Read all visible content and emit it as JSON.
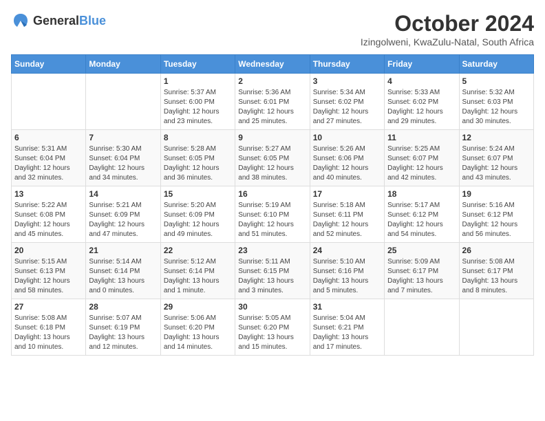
{
  "logo": {
    "general": "General",
    "blue": "Blue"
  },
  "title": "October 2024",
  "subtitle": "Izingolweni, KwaZulu-Natal, South Africa",
  "calendar": {
    "headers": [
      "Sunday",
      "Monday",
      "Tuesday",
      "Wednesday",
      "Thursday",
      "Friday",
      "Saturday"
    ],
    "weeks": [
      [
        {
          "day": "",
          "detail": ""
        },
        {
          "day": "",
          "detail": ""
        },
        {
          "day": "1",
          "detail": "Sunrise: 5:37 AM\nSunset: 6:00 PM\nDaylight: 12 hours\nand 23 minutes."
        },
        {
          "day": "2",
          "detail": "Sunrise: 5:36 AM\nSunset: 6:01 PM\nDaylight: 12 hours\nand 25 minutes."
        },
        {
          "day": "3",
          "detail": "Sunrise: 5:34 AM\nSunset: 6:02 PM\nDaylight: 12 hours\nand 27 minutes."
        },
        {
          "day": "4",
          "detail": "Sunrise: 5:33 AM\nSunset: 6:02 PM\nDaylight: 12 hours\nand 29 minutes."
        },
        {
          "day": "5",
          "detail": "Sunrise: 5:32 AM\nSunset: 6:03 PM\nDaylight: 12 hours\nand 30 minutes."
        }
      ],
      [
        {
          "day": "6",
          "detail": "Sunrise: 5:31 AM\nSunset: 6:04 PM\nDaylight: 12 hours\nand 32 minutes."
        },
        {
          "day": "7",
          "detail": "Sunrise: 5:30 AM\nSunset: 6:04 PM\nDaylight: 12 hours\nand 34 minutes."
        },
        {
          "day": "8",
          "detail": "Sunrise: 5:28 AM\nSunset: 6:05 PM\nDaylight: 12 hours\nand 36 minutes."
        },
        {
          "day": "9",
          "detail": "Sunrise: 5:27 AM\nSunset: 6:05 PM\nDaylight: 12 hours\nand 38 minutes."
        },
        {
          "day": "10",
          "detail": "Sunrise: 5:26 AM\nSunset: 6:06 PM\nDaylight: 12 hours\nand 40 minutes."
        },
        {
          "day": "11",
          "detail": "Sunrise: 5:25 AM\nSunset: 6:07 PM\nDaylight: 12 hours\nand 42 minutes."
        },
        {
          "day": "12",
          "detail": "Sunrise: 5:24 AM\nSunset: 6:07 PM\nDaylight: 12 hours\nand 43 minutes."
        }
      ],
      [
        {
          "day": "13",
          "detail": "Sunrise: 5:22 AM\nSunset: 6:08 PM\nDaylight: 12 hours\nand 45 minutes."
        },
        {
          "day": "14",
          "detail": "Sunrise: 5:21 AM\nSunset: 6:09 PM\nDaylight: 12 hours\nand 47 minutes."
        },
        {
          "day": "15",
          "detail": "Sunrise: 5:20 AM\nSunset: 6:09 PM\nDaylight: 12 hours\nand 49 minutes."
        },
        {
          "day": "16",
          "detail": "Sunrise: 5:19 AM\nSunset: 6:10 PM\nDaylight: 12 hours\nand 51 minutes."
        },
        {
          "day": "17",
          "detail": "Sunrise: 5:18 AM\nSunset: 6:11 PM\nDaylight: 12 hours\nand 52 minutes."
        },
        {
          "day": "18",
          "detail": "Sunrise: 5:17 AM\nSunset: 6:12 PM\nDaylight: 12 hours\nand 54 minutes."
        },
        {
          "day": "19",
          "detail": "Sunrise: 5:16 AM\nSunset: 6:12 PM\nDaylight: 12 hours\nand 56 minutes."
        }
      ],
      [
        {
          "day": "20",
          "detail": "Sunrise: 5:15 AM\nSunset: 6:13 PM\nDaylight: 12 hours\nand 58 minutes."
        },
        {
          "day": "21",
          "detail": "Sunrise: 5:14 AM\nSunset: 6:14 PM\nDaylight: 13 hours\nand 0 minutes."
        },
        {
          "day": "22",
          "detail": "Sunrise: 5:12 AM\nSunset: 6:14 PM\nDaylight: 13 hours\nand 1 minute."
        },
        {
          "day": "23",
          "detail": "Sunrise: 5:11 AM\nSunset: 6:15 PM\nDaylight: 13 hours\nand 3 minutes."
        },
        {
          "day": "24",
          "detail": "Sunrise: 5:10 AM\nSunset: 6:16 PM\nDaylight: 13 hours\nand 5 minutes."
        },
        {
          "day": "25",
          "detail": "Sunrise: 5:09 AM\nSunset: 6:17 PM\nDaylight: 13 hours\nand 7 minutes."
        },
        {
          "day": "26",
          "detail": "Sunrise: 5:08 AM\nSunset: 6:17 PM\nDaylight: 13 hours\nand 8 minutes."
        }
      ],
      [
        {
          "day": "27",
          "detail": "Sunrise: 5:08 AM\nSunset: 6:18 PM\nDaylight: 13 hours\nand 10 minutes."
        },
        {
          "day": "28",
          "detail": "Sunrise: 5:07 AM\nSunset: 6:19 PM\nDaylight: 13 hours\nand 12 minutes."
        },
        {
          "day": "29",
          "detail": "Sunrise: 5:06 AM\nSunset: 6:20 PM\nDaylight: 13 hours\nand 14 minutes."
        },
        {
          "day": "30",
          "detail": "Sunrise: 5:05 AM\nSunset: 6:20 PM\nDaylight: 13 hours\nand 15 minutes."
        },
        {
          "day": "31",
          "detail": "Sunrise: 5:04 AM\nSunset: 6:21 PM\nDaylight: 13 hours\nand 17 minutes."
        },
        {
          "day": "",
          "detail": ""
        },
        {
          "day": "",
          "detail": ""
        }
      ]
    ]
  }
}
